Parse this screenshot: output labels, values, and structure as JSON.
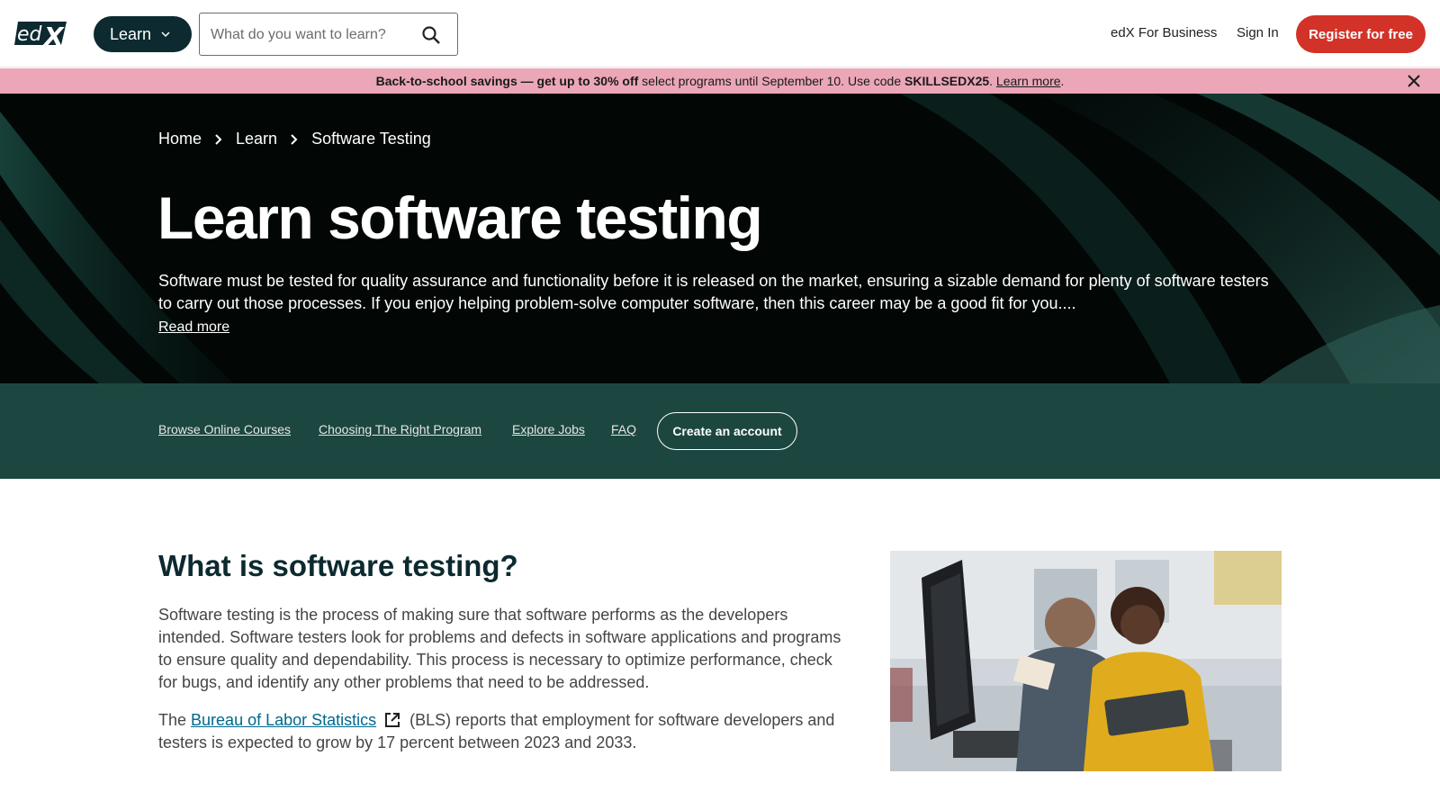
{
  "header": {
    "logo_icon": "edx-logo",
    "learn_label": "Learn",
    "search_placeholder": "What do you want to learn?",
    "business_label": "edX For Business",
    "signin_label": "Sign In",
    "register_label": "Register for free"
  },
  "promo": {
    "bold_text": "Back-to-school savings — get up to 30% off",
    "middle_text": " select programs until September 10. Use code ",
    "code": "SKILLSEDX25",
    "period": ".",
    "link_text": "Learn more",
    "end_text": "."
  },
  "breadcrumb": {
    "items": [
      "Home",
      "Learn",
      "Software Testing"
    ]
  },
  "hero": {
    "title": "Learn software testing",
    "description": "Software must be tested for quality assurance and functionality before it is released on the market, ensuring a sizable demand for plenty of software testers to carry out those processes. If you enjoy helping problem-solve computer software, then this career may be a good fit for you....",
    "read_more": "Read more"
  },
  "subnav": {
    "links": [
      "Browse Online Courses",
      "Choosing The Right Program",
      "Explore Jobs",
      "FAQ"
    ],
    "cta": "Create an account"
  },
  "section": {
    "heading": "What is software testing?",
    "para1": "Software testing is the process of making sure that software performs as the developers intended. Software testers look for problems and defects in software applications and programs to ensure quality and dependability. This process is necessary to optimize performance, check for bugs, and identify any other problems that need to be addressed.",
    "para2_before": "The ",
    "para2_link": "Bureau of Labor Statistics",
    "para2_after": " (BLS) reports that employment for software developers and testers is expected to grow by 17 percent between 2023 and 2033."
  },
  "colors": {
    "brand_dark": "#0c2a2f",
    "register": "#d23228",
    "promo_bg": "#eba6b8",
    "subnav_bg": "#1c4740",
    "link": "#00688d"
  }
}
